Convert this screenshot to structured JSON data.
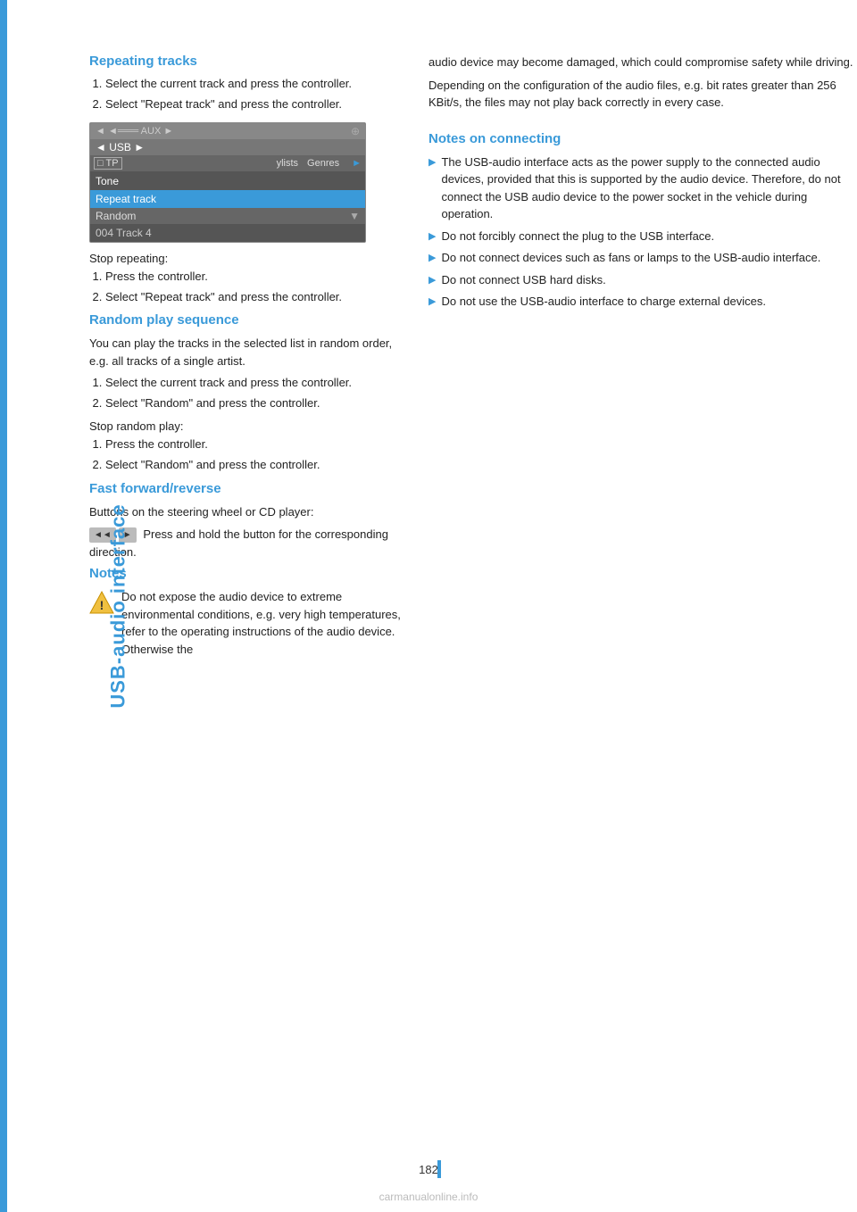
{
  "sidebar": {
    "label": "USB-audio interface",
    "bar_color": "#3a9ad9"
  },
  "page_number": "182",
  "sections": {
    "repeating_tracks": {
      "title": "Repeating tracks",
      "steps": [
        "Select the current track and press the controller.",
        "Select \"Repeat track\" and press the controller."
      ],
      "stop_label": "Stop repeating:",
      "stop_steps": [
        "Press the controller.",
        "Select \"Repeat track\" and press the controller."
      ]
    },
    "random_play": {
      "title": "Random play sequence",
      "intro": "You can play the tracks in the selected list in random order, e.g. all tracks of a single artist.",
      "steps": [
        "Select the current track and press the controller.",
        "Select \"Random\" and press the controller."
      ],
      "stop_label": "Stop random play:",
      "stop_steps": [
        "Press the controller.",
        "Select \"Random\" and press the controller."
      ]
    },
    "fast_forward": {
      "title": "Fast forward/reverse",
      "intro": "Buttons on the steering wheel or CD player:",
      "button_left": "◄◄",
      "button_right": "►",
      "description": "Press and hold the button for the corresponding direction."
    },
    "notes": {
      "title": "Notes",
      "warning_text": "Do not expose the audio device to extreme environmental conditions, e.g. very high temperatures, refer to the operating instructions of the audio device. Otherwise the"
    },
    "notes_on_connecting": {
      "title": "Notes on connecting",
      "intro_text1": "audio device may become damaged, which could compromise safety while driving.",
      "intro_text2": "Depending on the configuration of the audio files, e.g. bit rates greater than 256 KBit/s, the files may not play back correctly in every case.",
      "bullets": [
        "The USB-audio interface acts as the power supply to the connected audio devices, provided that this is supported by the audio device. Therefore, do not connect the USB audio device to the power socket in the vehicle during operation.",
        "Do not forcibly connect the plug to the USB interface.",
        "Do not connect devices such as fans or lamps to the USB-audio interface.",
        "Do not connect USB hard disks.",
        "Do not use the USB-audio interface to charge external devices."
      ]
    }
  },
  "screen_mockup": {
    "top_bar_left": "◄ ◄══ AUX ►",
    "top_bar_right": "⊕",
    "second_bar": "◄ USB ►",
    "menu_row_tp": "□ TP",
    "menu_row_items": [
      "ylists",
      "Genres",
      "►"
    ],
    "items": [
      {
        "label": "Tone",
        "selected": false
      },
      {
        "label": "Repeat track",
        "selected": true
      },
      {
        "label": "Random",
        "selected": false,
        "arrow": "▼"
      },
      {
        "label": "004 Track 4",
        "selected": false,
        "bottom": true
      }
    ]
  },
  "watermark": "carmanualonline.info"
}
